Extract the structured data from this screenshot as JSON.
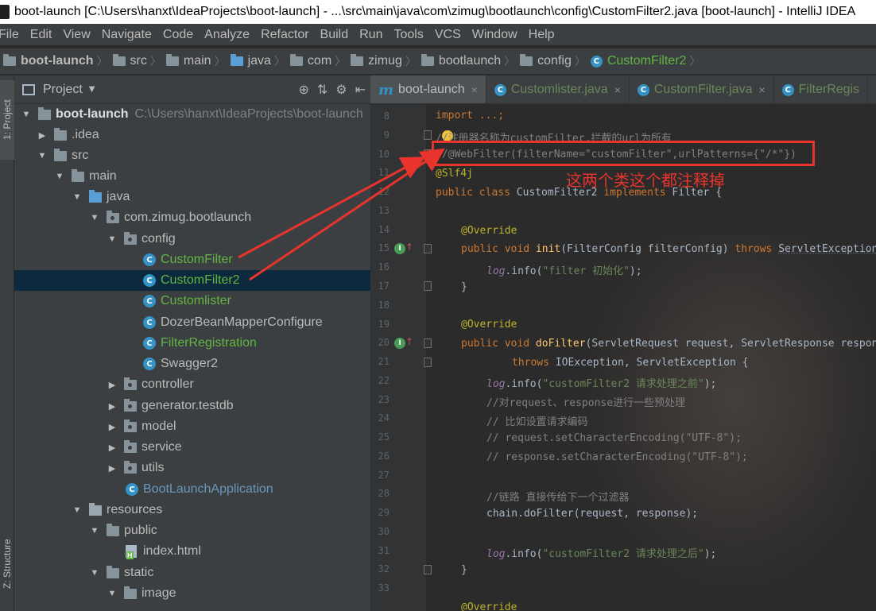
{
  "window": {
    "title": "boot-launch [C:\\Users\\hanxt\\IdeaProjects\\boot-launch] - ...\\src\\main\\java\\com\\zimug\\bootlaunch\\config\\CustomFilter2.java [boot-launch] - IntelliJ IDEA"
  },
  "menu": {
    "items": [
      "File",
      "Edit",
      "View",
      "Navigate",
      "Code",
      "Analyze",
      "Refactor",
      "Build",
      "Run",
      "Tools",
      "VCS",
      "Window",
      "Help"
    ]
  },
  "breadcrumb": {
    "items": [
      "boot-launch",
      "src",
      "main",
      "java",
      "com",
      "zimug",
      "bootlaunch",
      "config",
      "CustomFilter2"
    ]
  },
  "sidebar": {
    "project_tab": "1: Project",
    "structure_tab": "Z: Structure"
  },
  "project_panel": {
    "title": "Project",
    "tree": [
      {
        "label": "boot-launch",
        "hint": "C:\\Users\\hanxt\\IdeaProjects\\boot-launch"
      },
      {
        "label": ".idea"
      },
      {
        "label": "src"
      },
      {
        "label": "main"
      },
      {
        "label": "java"
      },
      {
        "label": "com.zimug.bootlaunch"
      },
      {
        "label": "config"
      },
      {
        "label": "CustomFilter"
      },
      {
        "label": "CustomFilter2"
      },
      {
        "label": "Customlister"
      },
      {
        "label": "DozerBeanMapperConfigure"
      },
      {
        "label": "FilterRegistration"
      },
      {
        "label": "Swagger2"
      },
      {
        "label": "controller"
      },
      {
        "label": "generator.testdb"
      },
      {
        "label": "model"
      },
      {
        "label": "service"
      },
      {
        "label": "utils"
      },
      {
        "label": "BootLaunchApplication"
      },
      {
        "label": "resources"
      },
      {
        "label": "public"
      },
      {
        "label": "index.html"
      },
      {
        "label": "static"
      },
      {
        "label": "image"
      }
    ]
  },
  "editor": {
    "tabs": [
      "boot-launch",
      "Customlister.java",
      "CustomFilter.java",
      "FilterRegis"
    ],
    "line_numbers": [
      "8",
      "9",
      "10",
      "11",
      "12",
      "13",
      "14",
      "15",
      "16",
      "17",
      "18",
      "19",
      "20",
      "21",
      "22",
      "23",
      "24",
      "25",
      "26",
      "27",
      "28",
      "29",
      "30",
      "31",
      "32",
      "33"
    ],
    "code": {
      "l8": "import ...;",
      "l9": "//注册器名称为customFilter,拦截的url为所有",
      "l10": "//@WebFilter(filterName=\"customFilter\",urlPatterns={\"/*\"})",
      "l11": "@Slf4j",
      "l12_a": "public class ",
      "l12_b": "CustomFilter2 ",
      "l12_c": "implements ",
      "l12_d": "Filter {",
      "l14": "@Override",
      "l15_a": "public void ",
      "l15_b": "init",
      "l15_c": "(FilterConfig filterConfig) ",
      "l15_d": "throws ",
      "l15_e": "ServletException {",
      "l16_a": "log",
      "l16_b": ".info(",
      "l16_c": "\"filter 初始化\"",
      "l16_d": ");",
      "l17": "}",
      "l19": "@Override",
      "l20_a": "public void ",
      "l20_b": "doFilter",
      "l20_c": "(ServletRequest request, ServletResponse response,",
      "l21_a": "throws ",
      "l21_b": "IOException, ServletException {",
      "l22_a": "log",
      "l22_b": ".info(",
      "l22_c": "\"customFilter2 请求处理之前\"",
      "l22_d": ");",
      "l23": "//对request、response进行一些预处理",
      "l24": "// 比如设置请求编码",
      "l25": "// request.setCharacterEncoding(\"UTF-8\");",
      "l26": "// response.setCharacterEncoding(\"UTF-8\");",
      "l28": "//链路 直接传给下一个过滤器",
      "l29": "chain.doFilter(request, response);",
      "l31_a": "log",
      "l31_b": ".info(",
      "l31_c": "\"customFilter2 请求处理之后\"",
      "l31_d": ");",
      "l32": "}",
      "l34": "@Override"
    }
  },
  "annotation": {
    "text": "这两个类这个都注释掉",
    "color": "#e8342c"
  },
  "colors": {
    "accent_green": "#62b543",
    "selection": "#0d293e",
    "class_icon": "#3592c4"
  }
}
